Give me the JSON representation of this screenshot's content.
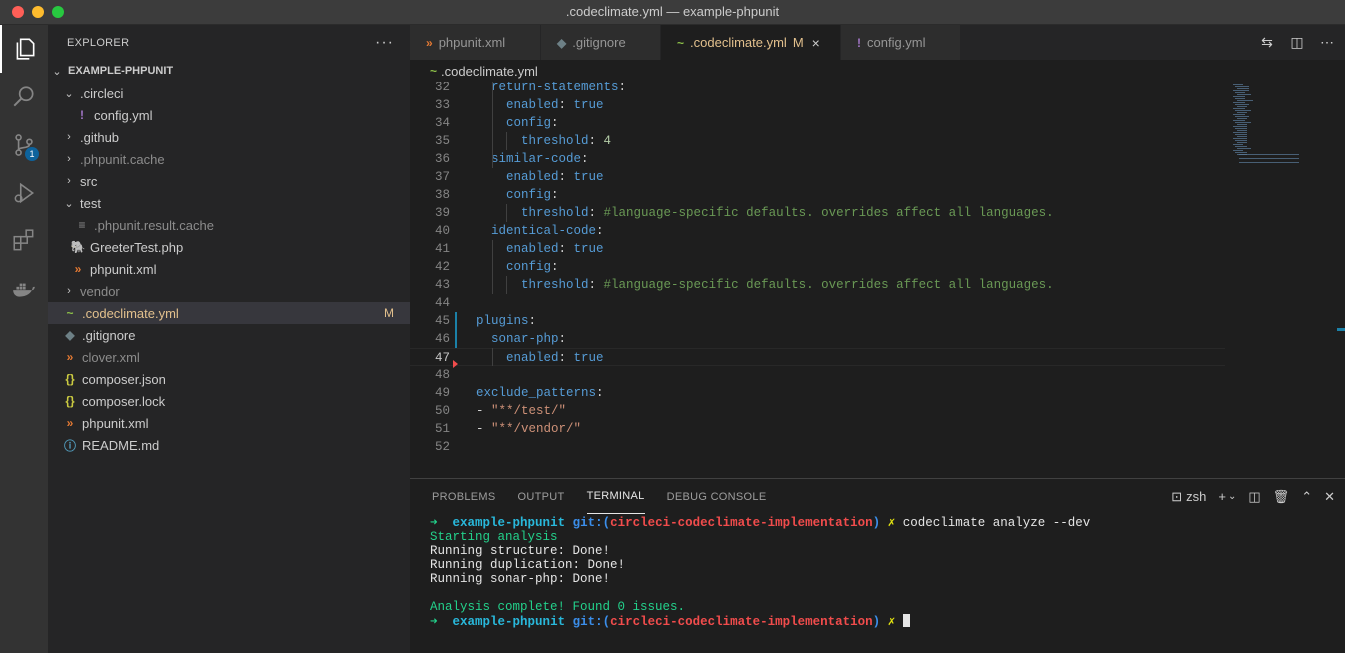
{
  "window": {
    "title": ".codeclimate.yml — example-phpunit"
  },
  "activity_bar": {
    "scm_badge": "1"
  },
  "sidebar": {
    "header": "EXPLORER",
    "more": "···",
    "project": "EXAMPLE-PHPUNIT",
    "items": [
      {
        "label": ".circleci",
        "type": "folder-open"
      },
      {
        "label": "config.yml",
        "type": "file",
        "icon": "!"
      },
      {
        "label": ".github",
        "type": "folder"
      },
      {
        "label": ".phpunit.cache",
        "type": "folder"
      },
      {
        "label": "src",
        "type": "folder"
      },
      {
        "label": "test",
        "type": "folder-open"
      },
      {
        "label": ".phpunit.result.cache",
        "type": "file",
        "icon": "≡"
      },
      {
        "label": "GreeterTest.php",
        "type": "file",
        "icon": "🐘"
      },
      {
        "label": "phpunit.xml",
        "type": "file",
        "icon": "»"
      },
      {
        "label": "vendor",
        "type": "folder"
      },
      {
        "label": ".codeclimate.yml",
        "type": "file",
        "icon": "~",
        "badge": "M"
      },
      {
        "label": ".gitignore",
        "type": "file",
        "icon": "◆"
      },
      {
        "label": "clover.xml",
        "type": "file",
        "icon": "»"
      },
      {
        "label": "composer.json",
        "type": "file",
        "icon": "{}"
      },
      {
        "label": "composer.lock",
        "type": "file",
        "icon": "{}"
      },
      {
        "label": "phpunit.xml",
        "type": "file",
        "icon": "»"
      },
      {
        "label": "README.md",
        "type": "file",
        "icon": "ⓘ"
      }
    ]
  },
  "tabs": [
    {
      "label": "phpunit.xml",
      "icon": "»"
    },
    {
      "label": ".gitignore",
      "icon": "◆"
    },
    {
      "label": ".codeclimate.yml",
      "icon": "~",
      "mark": "M",
      "close": "×"
    },
    {
      "label": "config.yml",
      "icon": "!"
    }
  ],
  "breadcrumb": {
    "label": ".codeclimate.yml"
  },
  "editor": {
    "lines": [
      {
        "n": "32",
        "indent": "  ",
        "key": "return-statements",
        "rest": ":"
      },
      {
        "n": "33",
        "indent": "    ",
        "key": "enabled",
        "rest": ": ",
        "val": "true"
      },
      {
        "n": "34",
        "indent": "    ",
        "key": "config",
        "rest": ":"
      },
      {
        "n": "35",
        "indent": "      ",
        "key": "threshold",
        "rest": ": ",
        "num": "4"
      },
      {
        "n": "36",
        "indent": "  ",
        "key": "similar-code",
        "rest": ":"
      },
      {
        "n": "37",
        "indent": "    ",
        "key": "enabled",
        "rest": ": ",
        "val": "true"
      },
      {
        "n": "38",
        "indent": "    ",
        "key": "config",
        "rest": ":"
      },
      {
        "n": "39",
        "indent": "      ",
        "key": "threshold",
        "rest": ": ",
        "com": "#language-specific defaults. overrides affect all languages."
      },
      {
        "n": "40",
        "indent": "  ",
        "key": "identical-code",
        "rest": ":"
      },
      {
        "n": "41",
        "indent": "    ",
        "key": "enabled",
        "rest": ": ",
        "val": "true"
      },
      {
        "n": "42",
        "indent": "    ",
        "key": "config",
        "rest": ":"
      },
      {
        "n": "43",
        "indent": "      ",
        "key": "threshold",
        "rest": ": ",
        "com": "#language-specific defaults. overrides affect all languages."
      },
      {
        "n": "44",
        "indent": "",
        "key": "",
        "rest": ""
      },
      {
        "n": "45",
        "indent": "",
        "key": "plugins",
        "rest": ":"
      },
      {
        "n": "46",
        "indent": "  ",
        "key": "sonar-php",
        "rest": ":"
      },
      {
        "n": "47",
        "indent": "    ",
        "key": "enabled",
        "rest": ": ",
        "val": "true"
      },
      {
        "n": "48",
        "indent": "",
        "key": "",
        "rest": ""
      },
      {
        "n": "49",
        "indent": "",
        "key": "exclude_patterns",
        "rest": ":"
      },
      {
        "n": "50",
        "indent": "",
        "key": "",
        "rest": "- ",
        "str": "\"**/test/\""
      },
      {
        "n": "51",
        "indent": "",
        "key": "",
        "rest": "- ",
        "str": "\"**/vendor/\""
      },
      {
        "n": "52",
        "indent": "",
        "key": "",
        "rest": ""
      }
    ]
  },
  "panel": {
    "tabs": [
      "PROBLEMS",
      "OUTPUT",
      "TERMINAL",
      "DEBUG CONSOLE"
    ],
    "active_tab": "TERMINAL",
    "shell": "zsh",
    "terminal": {
      "prompt_arrow": "➜",
      "prompt_dir": "example-phpunit",
      "prompt_git": "git:(",
      "prompt_branch": "circleci-codeclimate-implementation",
      "prompt_git_close": ")",
      "prompt_x": "✗",
      "command": "codeclimate analyze --dev",
      "line1": "Starting analysis",
      "line2": "Running structure: Done!",
      "line3": "Running duplication: Done!",
      "line4": "Running sonar-php: Done!",
      "line5": "Analysis complete! Found 0 issues."
    }
  }
}
